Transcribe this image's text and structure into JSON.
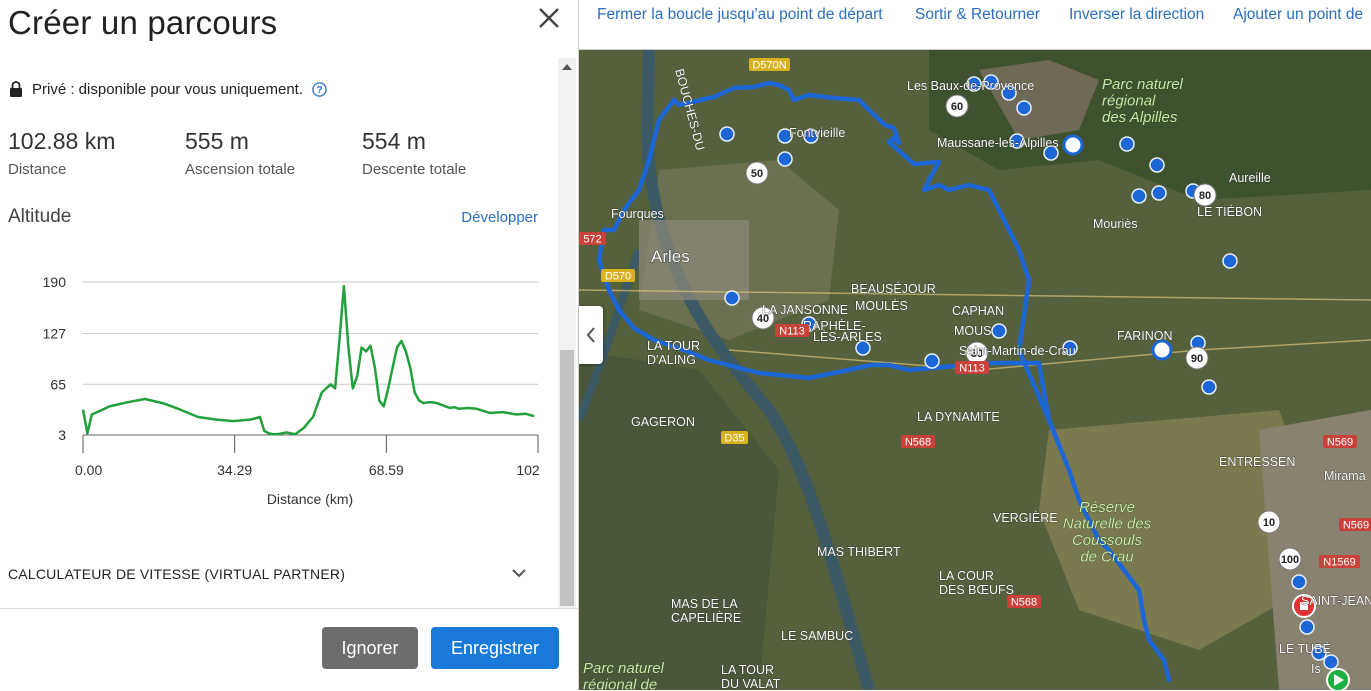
{
  "panel": {
    "title": "Créer un parcours",
    "privacy_text": "Privé : disponible pour vous uniquement.",
    "stats": [
      {
        "value": "102.88 km",
        "label": "Distance"
      },
      {
        "value": "555 m",
        "label": "Ascension totale"
      },
      {
        "value": "554 m",
        "label": "Descente totale"
      }
    ],
    "altitude_title": "Altitude",
    "expand_link": "Développer",
    "speed_calculator": "CALCULATEUR DE VITESSE (VIRTUAL PARTNER)",
    "buttons": {
      "ignore": "Ignorer",
      "save": "Enregistrer"
    }
  },
  "chart_data": {
    "type": "line",
    "xlabel": "Distance (km)",
    "x_ticks": [
      "0.00",
      "34.29",
      "68.59",
      "102"
    ],
    "y_ticks": [
      "190",
      "127",
      "65",
      "3"
    ],
    "xlim": [
      0,
      102.88
    ],
    "ylim": [
      3,
      190
    ],
    "color": "#22a03c",
    "series": [
      {
        "x": [
          0,
          1,
          2,
          4,
          6,
          10,
          14,
          18,
          22,
          26,
          30,
          34,
          38,
          40,
          41,
          42,
          43,
          44,
          46,
          48,
          50,
          52,
          54,
          56,
          57,
          58,
          59,
          60,
          61,
          62,
          63,
          64,
          65,
          66,
          67,
          68,
          69,
          70,
          71,
          72,
          73,
          74,
          75,
          76,
          77,
          78,
          79,
          80,
          81,
          82,
          83,
          84,
          85,
          87,
          89,
          92,
          95,
          98,
          100,
          102
        ],
        "y": [
          34,
          5,
          28,
          33,
          38,
          43,
          47,
          42,
          34,
          25,
          22,
          20,
          22,
          25,
          8,
          5,
          4,
          4,
          6,
          4,
          12,
          25,
          55,
          65,
          60,
          120,
          185,
          110,
          60,
          75,
          110,
          105,
          112,
          85,
          45,
          38,
          60,
          85,
          110,
          118,
          105,
          85,
          55,
          45,
          42,
          43,
          43,
          42,
          40,
          38,
          36,
          37,
          35,
          36,
          35,
          30,
          31,
          28,
          29,
          26
        ]
      }
    ]
  },
  "toolbar": {
    "close_loop": "Fermer la boucle jusqu'au point de départ",
    "out_back": "Sortir & Retourner",
    "reverse": "Inverser la direction",
    "add_start": "Ajouter un point de"
  },
  "map": {
    "places": {
      "arles": "Arles",
      "fourques": "Fourques",
      "fontvieille": "Fontvieille",
      "les_baux": "Les Baux-de-Provence",
      "maussane": "Maussane-les-Alpilles",
      "mouries": "Mouriès",
      "aureille": "Aureille",
      "le_tiebon": "LE TIÉBON",
      "beausejour": "BEAUSÉJOUR",
      "moules": "MOULÈS",
      "la_jansonne": "LA JANSONNE",
      "raphele": "RAPHÈLE-",
      "les_arles": "LÈS-ARLES",
      "caphan": "CAPHAN",
      "mous": "MOUS",
      "saint_martin": "Saint-Martin-de-Crau",
      "farinon": "FARINON",
      "la_tour_daling": "LA TOUR\nD'ALING",
      "gageron": "GAGERON",
      "la_dynamite": "LA DYNAMITE",
      "vergiere": "VERGIÈRE",
      "entressen": "ENTRESSEN",
      "miramas": "Mirama",
      "mas_thibert": "MAS THIBERT",
      "la_cour_des_boeufs": "LA COUR\nDES BŒUFS",
      "mas_de_la_capeliere": "MAS DE LA\nCAPELIÈRE",
      "le_sambuc": "LE SAMBUC",
      "la_tour_du_valat": "LA TOUR\nDU VALAT",
      "saint_jean": "SAINT-JEAN",
      "le_tube": "LE TUBÉ",
      "istres": "Is",
      "bouches_du_rhone": "BOUCHES-DU",
      "park_alpilles": "Parc naturel\nrégional\ndes Alpilles",
      "park_camargue": "Parc naturel\nrégional de",
      "reserve_crau": "Réserve\nNaturelle des\nCoussouls\nde Crau"
    },
    "roads": [
      "D570N",
      "572",
      "D570",
      "N113",
      "N113",
      "D35",
      "N568",
      "N568",
      "N569",
      "N569",
      "N1569"
    ],
    "km_markers": [
      "60",
      "50",
      "80",
      "40",
      "30",
      "90",
      "10",
      "100"
    ]
  }
}
